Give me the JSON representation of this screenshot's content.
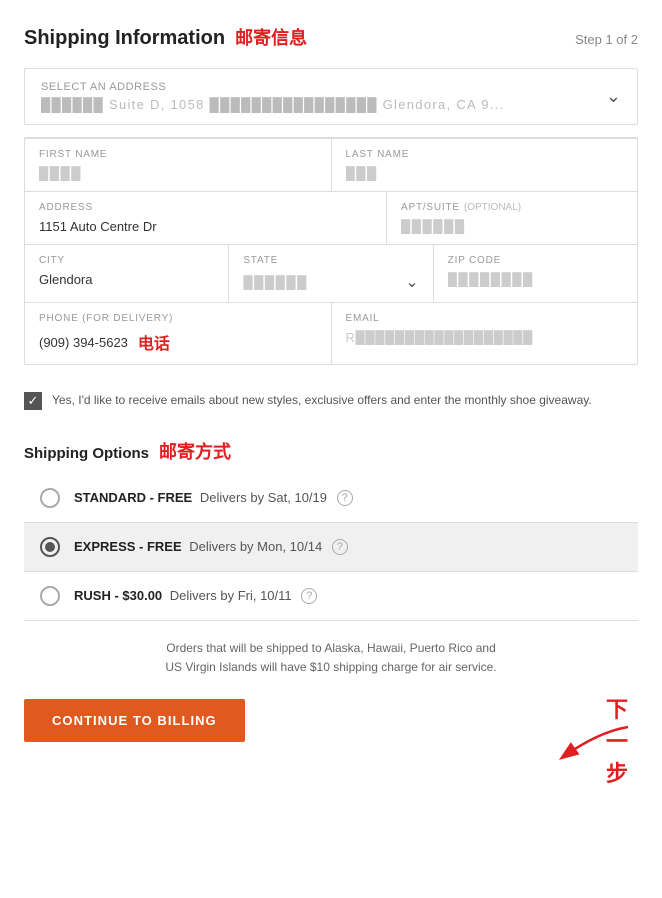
{
  "header": {
    "title": "Shipping Information",
    "chinese_label": "邮寄信息",
    "step": "Step 1 of 2"
  },
  "address_selector": {
    "label": "SELECT AN ADDRESS",
    "value": "████████ Suite D, 1058 ████████████████ Glendora, CA 9..."
  },
  "form": {
    "first_name": {
      "label": "FIRST NAME",
      "value": "████"
    },
    "last_name": {
      "label": "LAST NAME",
      "value": "███"
    },
    "address": {
      "label": "ADDRESS",
      "value": "1151 Auto Centre Dr"
    },
    "apt_suite": {
      "label": "APT/SUITE",
      "optional": "(OPTIONAL)",
      "value": "██████"
    },
    "city": {
      "label": "CITY",
      "value": "Glendora"
    },
    "state": {
      "label": "STATE",
      "value": "██████"
    },
    "zip_code": {
      "label": "ZIP CODE",
      "value": "████████"
    },
    "phone": {
      "label": "PHONE (FOR DELIVERY)",
      "value": "(909) 394-5623",
      "chinese_label": "电话"
    },
    "email": {
      "label": "EMAIL",
      "value": "R██████████████████"
    }
  },
  "checkbox": {
    "checked": true,
    "text": "Yes, I'd like to receive emails about new styles, exclusive offers and enter the monthly shoe giveaway."
  },
  "shipping_options": {
    "title": "Shipping Options",
    "chinese_label": "邮寄方式",
    "options": [
      {
        "id": "standard",
        "name": "STANDARD - FREE",
        "detail": "Delivers by Sat, 10/19",
        "selected": false
      },
      {
        "id": "express",
        "name": "EXPRESS - FREE",
        "detail": "Delivers by Mon, 10/14",
        "selected": true
      },
      {
        "id": "rush",
        "name": "RUSH - $30.00",
        "detail": "Delivers by Fri, 10/11",
        "selected": false
      }
    ]
  },
  "notice": {
    "text": "Orders that will be shipped to Alaska, Hawaii, Puerto Rico and\nUS Virgin Islands will have $10 shipping charge for air service."
  },
  "continue_button": {
    "label": "CONTINUE TO BILLING"
  },
  "annotation": {
    "chinese": "下一步"
  }
}
